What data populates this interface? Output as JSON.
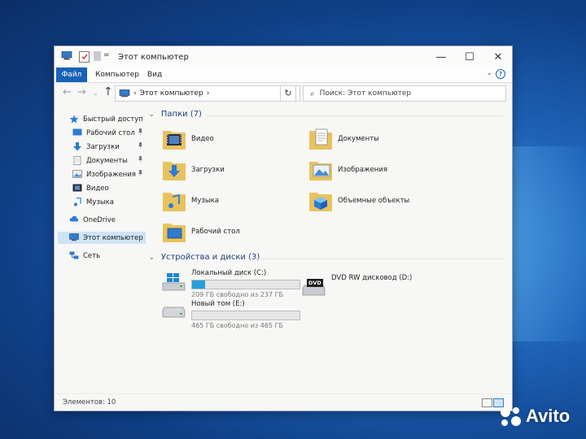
{
  "window": {
    "title": "Этот компьютер",
    "controls": {
      "minimize": "—",
      "maximize": "☐",
      "close": "✕"
    }
  },
  "quick_access_toolbar": {
    "dropdown": "="
  },
  "ribbon": {
    "tabs": [
      {
        "label": "Файл",
        "active": true
      },
      {
        "label": "Компьютер",
        "active": false
      },
      {
        "label": "Вид",
        "active": false
      }
    ],
    "collapse": "⌄",
    "help": "?"
  },
  "navigation": {
    "back": "←",
    "forward": "→",
    "recent": "⌄",
    "up": "↑",
    "address_path": "Этот компьютер",
    "address_separator": "›",
    "address_dropdown": "⌄",
    "refresh": "↻",
    "search_icon": "⌕",
    "search_placeholder": "Поиск: Этот компьютер"
  },
  "sidebar": {
    "items": [
      {
        "label": "Быстрый доступ",
        "icon": "star-icon",
        "pinned": false
      },
      {
        "label": "Рабочий стол",
        "icon": "desktop-icon",
        "pinned": true
      },
      {
        "label": "Загрузки",
        "icon": "downloads-icon",
        "pinned": true
      },
      {
        "label": "Документы",
        "icon": "documents-icon",
        "pinned": true
      },
      {
        "label": "Изображения",
        "icon": "pictures-icon",
        "pinned": true
      },
      {
        "label": "Видео",
        "icon": "video-icon",
        "pinned": false
      },
      {
        "label": "Музыка",
        "icon": "music-icon",
        "pinned": false
      },
      {
        "label": "OneDrive",
        "icon": "cloud-icon",
        "pinned": false
      },
      {
        "label": "Этот компьютер",
        "icon": "computer-icon",
        "pinned": false,
        "selected": true
      },
      {
        "label": "Сеть",
        "icon": "network-icon",
        "pinned": false
      }
    ],
    "pin_glyph": "📌"
  },
  "content": {
    "folders_header": "Папки (7)",
    "folders": [
      {
        "label": "Видео",
        "icon": "video-folder-icon"
      },
      {
        "label": "Документы",
        "icon": "documents-folder-icon"
      },
      {
        "label": "Загрузки",
        "icon": "downloads-folder-icon"
      },
      {
        "label": "Изображения",
        "icon": "pictures-folder-icon"
      },
      {
        "label": "Музыка",
        "icon": "music-folder-icon"
      },
      {
        "label": "Объемные объекты",
        "icon": "3d-objects-folder-icon"
      },
      {
        "label": "Рабочий стол",
        "icon": "desktop-folder-icon"
      }
    ],
    "drives_header": "Устройства и диски (3)",
    "drives": [
      {
        "label": "Локальный диск (C:)",
        "free": "209 ГБ свободно из 237 ГБ",
        "used_fraction": 0.12,
        "icon": "windows-drive-icon"
      },
      {
        "label": "Новый том (E:)",
        "free": "465 ГБ свободно из 465 ГБ",
        "used_fraction": 0.0,
        "icon": "hard-drive-icon"
      },
      {
        "label": "DVD RW дисковод (D:)",
        "icon": "dvd-drive-icon",
        "badge": "DVD"
      }
    ],
    "collapse_glyph": "⌄"
  },
  "statusbar": {
    "count": "Элементов: 10"
  },
  "watermark": {
    "text": "Avito"
  },
  "colors": {
    "accent": "#1a62b8",
    "folder": "#e8c25f",
    "drive_bar": "#26a0da"
  }
}
